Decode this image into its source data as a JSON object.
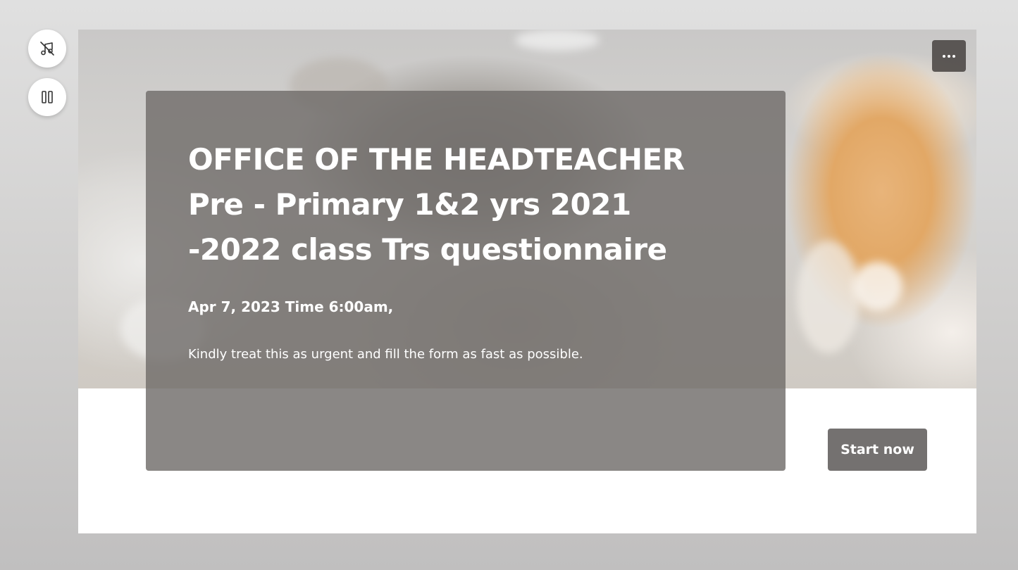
{
  "controls": {
    "music_button": {
      "icon": "music-off-icon"
    },
    "pause_button": {
      "icon": "pause-icon"
    }
  },
  "card": {
    "more_options": {
      "icon": "more-horizontal-icon"
    },
    "title": "OFFICE OF THE HEADTEACHER\nPre - Primary 1&2 yrs 2021\n-2022 class Trs questionnaire",
    "date": "Apr 7, 2023 Time 6:00am,",
    "description": "Kindly treat this as urgent and fill the form as fast as possible.",
    "start_label": "Start now"
  },
  "colors": {
    "panel_overlay": "#706c6a",
    "start_button": "#747170",
    "menu_button": "#46423f",
    "page_background": "#d0cfce"
  }
}
